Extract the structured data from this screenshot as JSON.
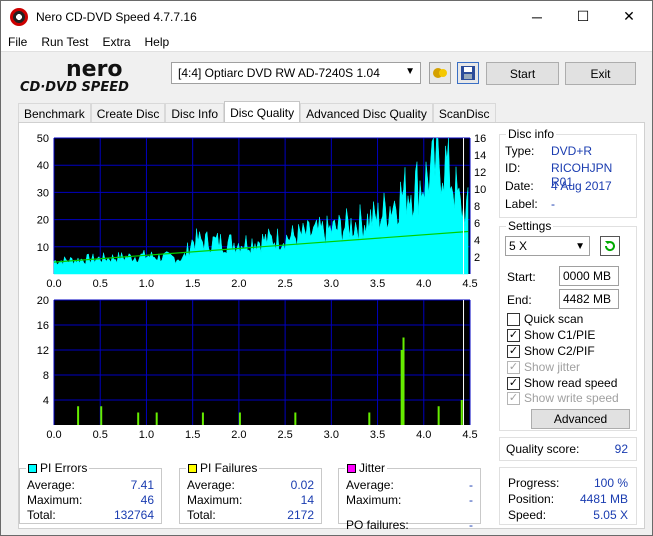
{
  "window": {
    "title": "Nero CD-DVD Speed 4.7.7.16",
    "minimize_glyph": "─",
    "maximize_glyph": "☐",
    "close_glyph": "✕"
  },
  "menu": [
    "File",
    "Run Test",
    "Extra",
    "Help"
  ],
  "logo": {
    "line1": "nero",
    "line2": "CD·DVD SPEED"
  },
  "toolbar": {
    "drive": "[4:4]  Optiarc DVD RW AD-7240S 1.04",
    "start": "Start",
    "exit": "Exit"
  },
  "tabs": [
    "Benchmark",
    "Create Disc",
    "Disc Info",
    "Disc Quality",
    "Advanced Disc Quality",
    "ScanDisc"
  ],
  "active_tab": "Disc Quality",
  "disc_info": {
    "title": "Disc info",
    "type_label": "Type:",
    "type": "DVD+R",
    "id_label": "ID:",
    "id": "RICOHJPN R01",
    "date_label": "Date:",
    "date": "4 Aug 2017",
    "label_label": "Label:",
    "label": "-"
  },
  "settings": {
    "title": "Settings",
    "speed": "5 X",
    "start_label": "Start:",
    "start": "0000 MB",
    "end_label": "End:",
    "end": "4482 MB",
    "quick_scan": "Quick scan",
    "show_c1": "Show C1/PIE",
    "show_c2": "Show C2/PIF",
    "show_jitter": "Show jitter",
    "show_read": "Show read speed",
    "show_write": "Show write speed",
    "advanced": "Advanced"
  },
  "quality": {
    "label": "Quality score:",
    "value": "92"
  },
  "progress": {
    "progress_label": "Progress:",
    "progress": "100 %",
    "position_label": "Position:",
    "position": "4481 MB",
    "speed_label": "Speed:",
    "speed": "5.05 X"
  },
  "pi_errors": {
    "title": "PI Errors",
    "avg_label": "Average:",
    "avg": "7.41",
    "max_label": "Maximum:",
    "max": "46",
    "total_label": "Total:",
    "total": "132764"
  },
  "pi_failures": {
    "title": "PI Failures",
    "avg_label": "Average:",
    "avg": "0.02",
    "max_label": "Maximum:",
    "max": "14",
    "total_label": "Total:",
    "total": "2172"
  },
  "jitter": {
    "title": "Jitter",
    "avg_label": "Average:",
    "avg": "-",
    "max_label": "Maximum:",
    "max": "-",
    "pof_label": "PO failures:",
    "pof": "-"
  },
  "colors": {
    "pie": "#00ffff",
    "pif": "#ffff00",
    "jitter": "#ff00ff",
    "read_speed": "#00d000",
    "grid": "#0000c0",
    "pif_bars": "#66ee00"
  },
  "chart_data": [
    {
      "type": "area",
      "title": "",
      "series": [
        {
          "name": "PI Errors",
          "x": [
            0,
            0.5,
            1.0,
            1.4,
            1.5,
            2.0,
            2.5,
            3.0,
            3.5,
            3.8,
            4.0,
            4.2,
            4.3,
            4.4
          ],
          "y": [
            5,
            6,
            7,
            6,
            13,
            12,
            14,
            17,
            22,
            32,
            36,
            45,
            38,
            25
          ]
        },
        {
          "name": "Read speed",
          "x": [
            0,
            4.48
          ],
          "y": [
            1.4,
            5.0
          ]
        }
      ],
      "x_ticks": [
        "0.0",
        "0.5",
        "1.0",
        "1.5",
        "2.0",
        "2.5",
        "3.0",
        "3.5",
        "4.0",
        "4.5"
      ],
      "y_ticks_left": [
        "10",
        "20",
        "30",
        "40",
        "50"
      ],
      "y_ticks_right": [
        "2",
        "4",
        "6",
        "8",
        "10",
        "12",
        "14",
        "16"
      ],
      "ylim": [
        0,
        50
      ],
      "ylim_right": [
        0,
        16
      ],
      "xlim": [
        0,
        4.5
      ],
      "grid": true
    },
    {
      "type": "bar",
      "title": "",
      "series": [
        {
          "name": "PI Failures",
          "x": [
            0.25,
            0.5,
            0.9,
            1.1,
            1.6,
            2.0,
            2.6,
            3.4,
            3.75,
            3.77,
            4.15,
            4.4
          ],
          "y": [
            3,
            3,
            2,
            2,
            2,
            2,
            2,
            2,
            12,
            14,
            3,
            4
          ]
        }
      ],
      "x_ticks": [
        "0.0",
        "0.5",
        "1.0",
        "1.5",
        "2.0",
        "2.5",
        "3.0",
        "3.5",
        "4.0",
        "4.5"
      ],
      "y_ticks": [
        "4",
        "8",
        "12",
        "16",
        "20"
      ],
      "ylim": [
        0,
        20
      ],
      "xlim": [
        0,
        4.5
      ],
      "grid": true
    }
  ]
}
